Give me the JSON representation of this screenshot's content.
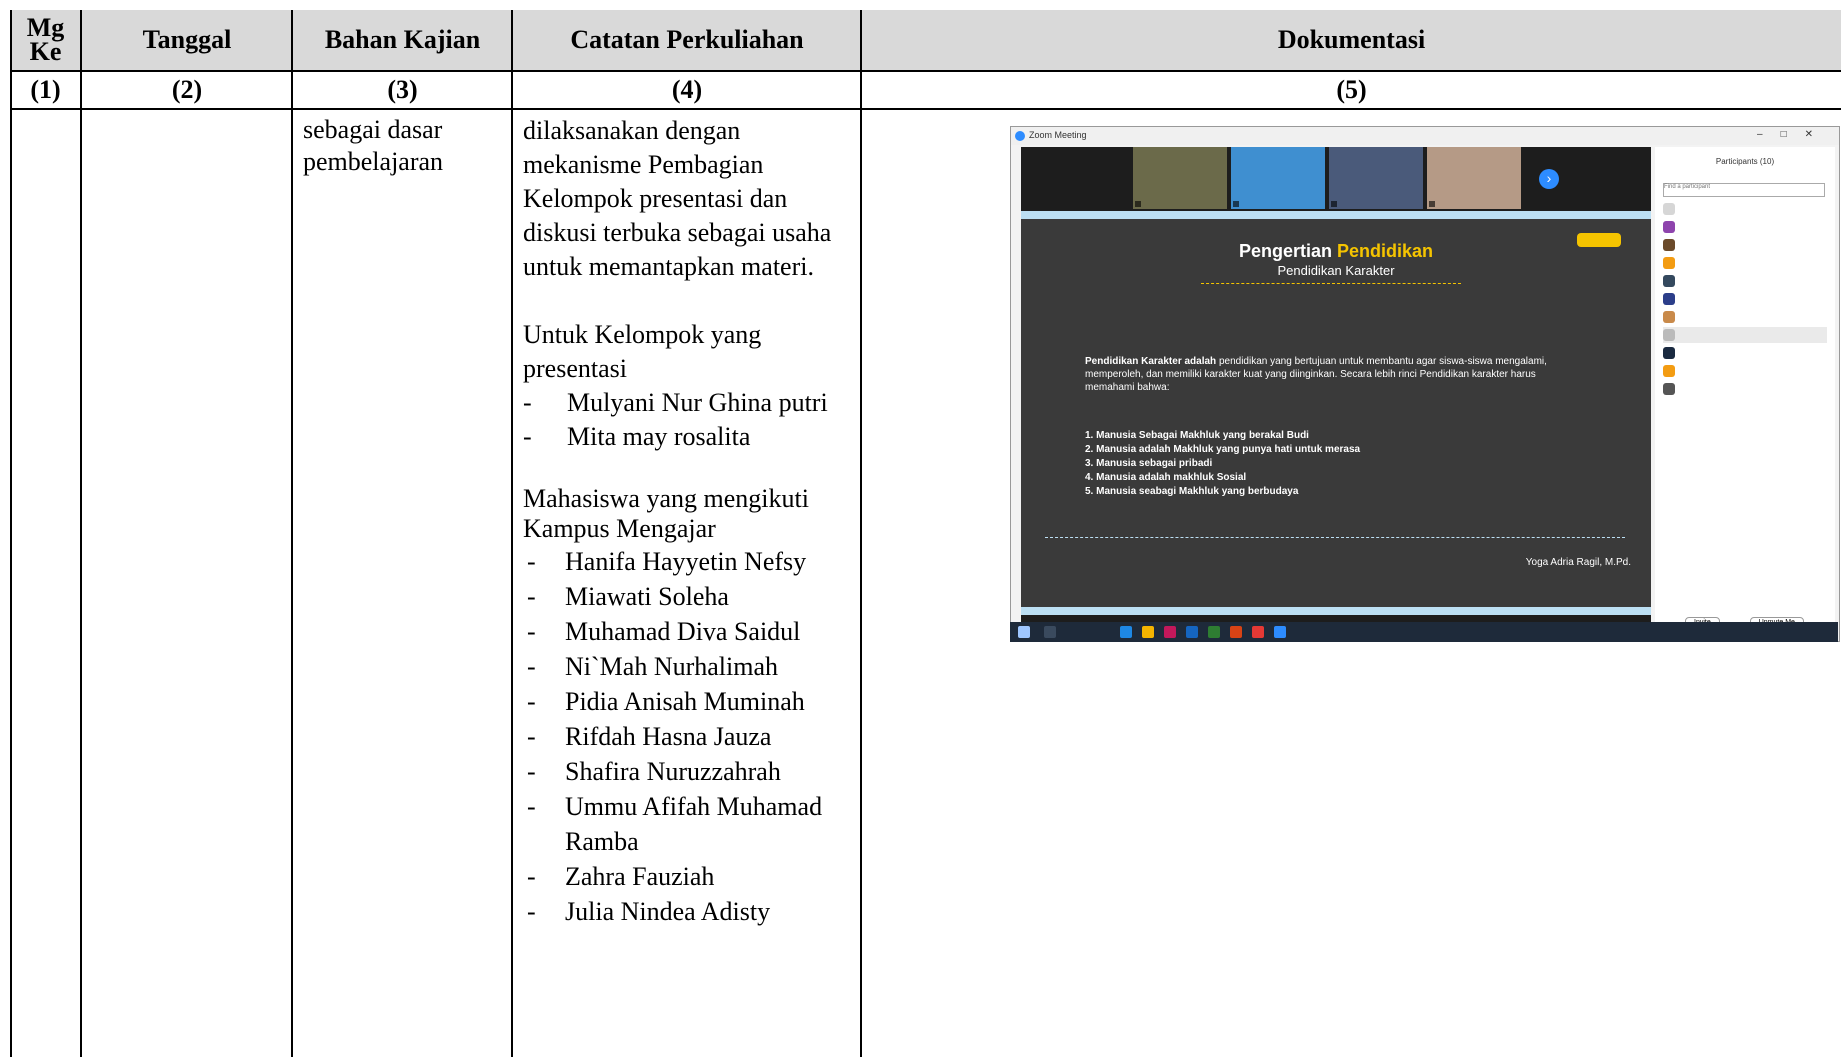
{
  "headers": {
    "col1": "Mg Ke",
    "col2": "Tanggal",
    "col3": "Bahan Kajian",
    "col4": "Catatan Perkuliahan",
    "col5": "Dokumentasi"
  },
  "numbers": [
    "(1)",
    "(2)",
    "(3)",
    "(4)",
    "(5)"
  ],
  "row": {
    "bahan_kajian_line1": "sebagai dasar",
    "bahan_kajian_line2": "pembelajaran",
    "catatan_intro": "dilaksanakan dengan mekanisme Pembagian Kelompok presentasi dan diskusi terbuka sebagai usaha untuk memantapkan materi.",
    "presentasi_heading": "Untuk Kelompok yang presentasi",
    "presentasi": [
      "Mulyani Nur Ghina putri",
      "Mita may rosalita"
    ],
    "kampus_heading": "Mahasiswa yang mengikuti Kampus Mengajar",
    "kampus": [
      "Hanifa Hayyetin Nefsy",
      "Miawati Soleha",
      "Muhamad Diva Saidul",
      "Ni`Mah Nurhalimah",
      "Pidia Anisah Muminah",
      "Rifdah Hasna Jauza",
      "Shafira Nuruzzahrah",
      "Ummu Afifah Muhamad Ramba",
      "Zahra Fauziah",
      "Julia Nindea Adisty"
    ]
  },
  "screenshot": {
    "window_title": "Zoom Meeting",
    "slide_title_white": "Pengertian",
    "slide_title_accent": "Pendidikan",
    "slide_subtitle": "Pendidikan Karakter",
    "slide_para_bold": "Pendidikan Karakter adalah",
    "slide_para": "pendidikan yang bertujuan untuk membantu agar siswa-siswa mengalami, memperoleh, dan memiliki karakter kuat yang diinginkan. Secara lebih rinci Pendidikan karakter harus memahami bahwa:",
    "slide_points": [
      "1.  Manusia Sebagai Makhluk yang berakal Budi",
      "2.  Manusia adalah Makhluk yang punya hati untuk merasa",
      "3.  Manusia sebagai pribadi",
      "4.  Manusia adalah makhluk Sosial",
      "5.  Manusia seabagi Makhluk yang berbudaya"
    ],
    "slide_author": "Yoga Adria Ragil, M.Pd.",
    "participants_title": "Participants (10)",
    "find_placeholder": "Find a participant",
    "invite_label": "Invite",
    "unmute_label": "Unmute Me",
    "accent_color": "#f5c400",
    "zoom_blue": "#2d8cff"
  }
}
